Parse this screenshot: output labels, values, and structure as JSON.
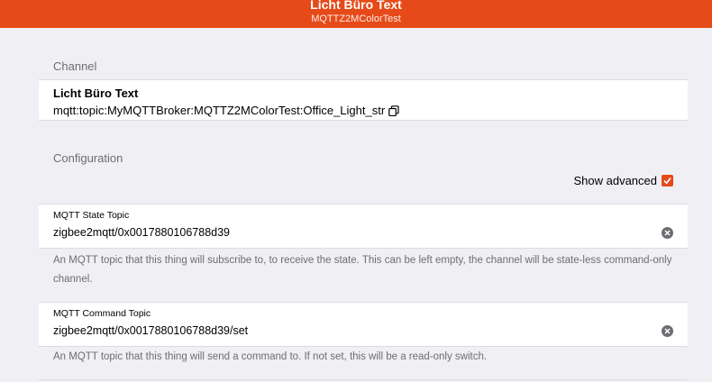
{
  "header": {
    "title": "Licht Büro Text",
    "subtitle": "MQTTZ2MColorTest"
  },
  "channel_section": {
    "title": "Channel",
    "name": "Licht Büro Text",
    "uid": "mqtt:topic:MyMQTTBroker:MQTTZ2MColorTest:Office_Light_str",
    "copy_icon": "copy-icon"
  },
  "config_section": {
    "title": "Configuration",
    "show_advanced_label": "Show advanced",
    "show_advanced_checked": true
  },
  "fields": [
    {
      "label": "MQTT State Topic",
      "value": "zigbee2mqtt/0x0017880106788d39",
      "help": "An MQTT topic that this thing will subscribe to, to receive the state. This can be left empty, the channel will be state-less command-only channel."
    },
    {
      "label": "MQTT Command Topic",
      "value": "zigbee2mqtt/0x0017880106788d39/set",
      "help": "An MQTT topic that this thing will send a command to. If not set, this will be a read-only switch."
    }
  ],
  "colors": {
    "accent": "#e64a19",
    "background": "#efeff4",
    "secondary_text": "#6d6d72"
  }
}
